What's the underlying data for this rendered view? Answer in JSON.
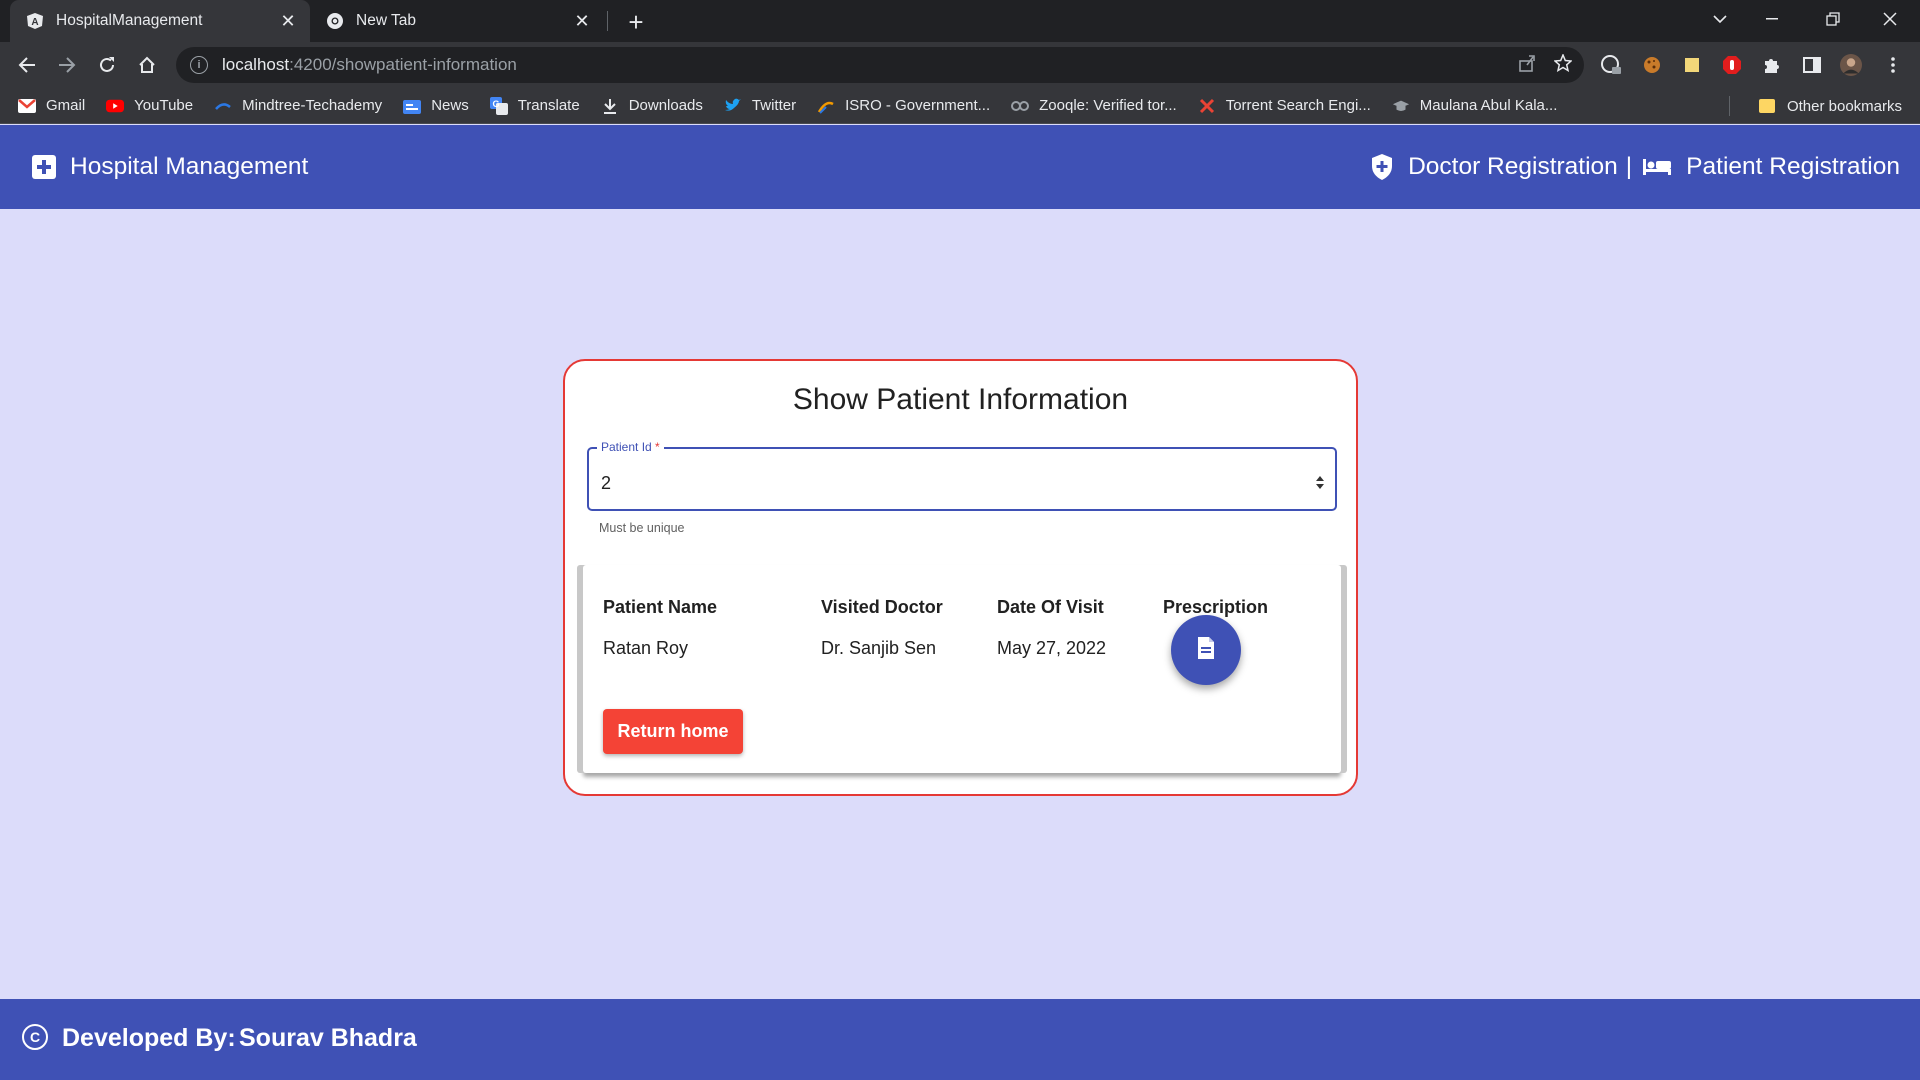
{
  "browser": {
    "tabs": [
      {
        "title": "HospitalManagement",
        "icon": "angular-icon",
        "active": true
      },
      {
        "title": "New Tab",
        "icon": "chrome-icon",
        "active": false
      }
    ],
    "url_host": "localhost",
    "url_path": ":4200/showpatient-information",
    "bookmarks": [
      {
        "label": "Gmail",
        "icon": "gmail-icon",
        "color": "#ea4335"
      },
      {
        "label": "YouTube",
        "icon": "youtube-icon",
        "color": "#ff0000"
      },
      {
        "label": "Mindtree-Techademy",
        "icon": "mindtree-icon",
        "color": "#2b78e4"
      },
      {
        "label": "News",
        "icon": "google-news-icon",
        "color": "#4285f4"
      },
      {
        "label": "Translate",
        "icon": "google-translate-icon",
        "color": "#4285f4"
      },
      {
        "label": "Downloads",
        "icon": "download-icon",
        "color": "#e8eaed"
      },
      {
        "label": "Twitter",
        "icon": "twitter-icon",
        "color": "#1da1f2"
      },
      {
        "label": "ISRO - Government...",
        "icon": "isro-icon",
        "color": "#f29900"
      },
      {
        "label": "Zooqle: Verified tor...",
        "icon": "zooqle-icon",
        "color": "#9aa0a6"
      },
      {
        "label": "Torrent Search Engi...",
        "icon": "torrent-icon",
        "color": "#ea4335"
      },
      {
        "label": "Maulana Abul Kala...",
        "icon": "graduation-cap-icon",
        "color": "#9aa0a6"
      }
    ],
    "other_bookmarks": "Other bookmarks"
  },
  "header": {
    "brand": "Hospital Management",
    "doctor_registration": "Doctor Registration",
    "divider": "|",
    "patient_registration": "Patient Registration",
    "color": "#3f51b5"
  },
  "form": {
    "title": "Show Patient Information",
    "patient_id_label": "Patient Id",
    "required_mark": "*",
    "patient_id_value": "2",
    "hint": "Must be unique"
  },
  "table": {
    "headers": [
      "Patient Name",
      "Visited Doctor",
      "Date Of Visit",
      "Prescription"
    ],
    "row": {
      "patient_name": "Ratan Roy",
      "visited_doctor": "Dr. Sanjib Sen",
      "date_of_visit": "May 27, 2022",
      "prescription_icon": "document-icon"
    }
  },
  "return_button": "Return home",
  "footer": {
    "developed_by_label": "Developed By:",
    "developer_name": "Sourav Bhadra"
  }
}
